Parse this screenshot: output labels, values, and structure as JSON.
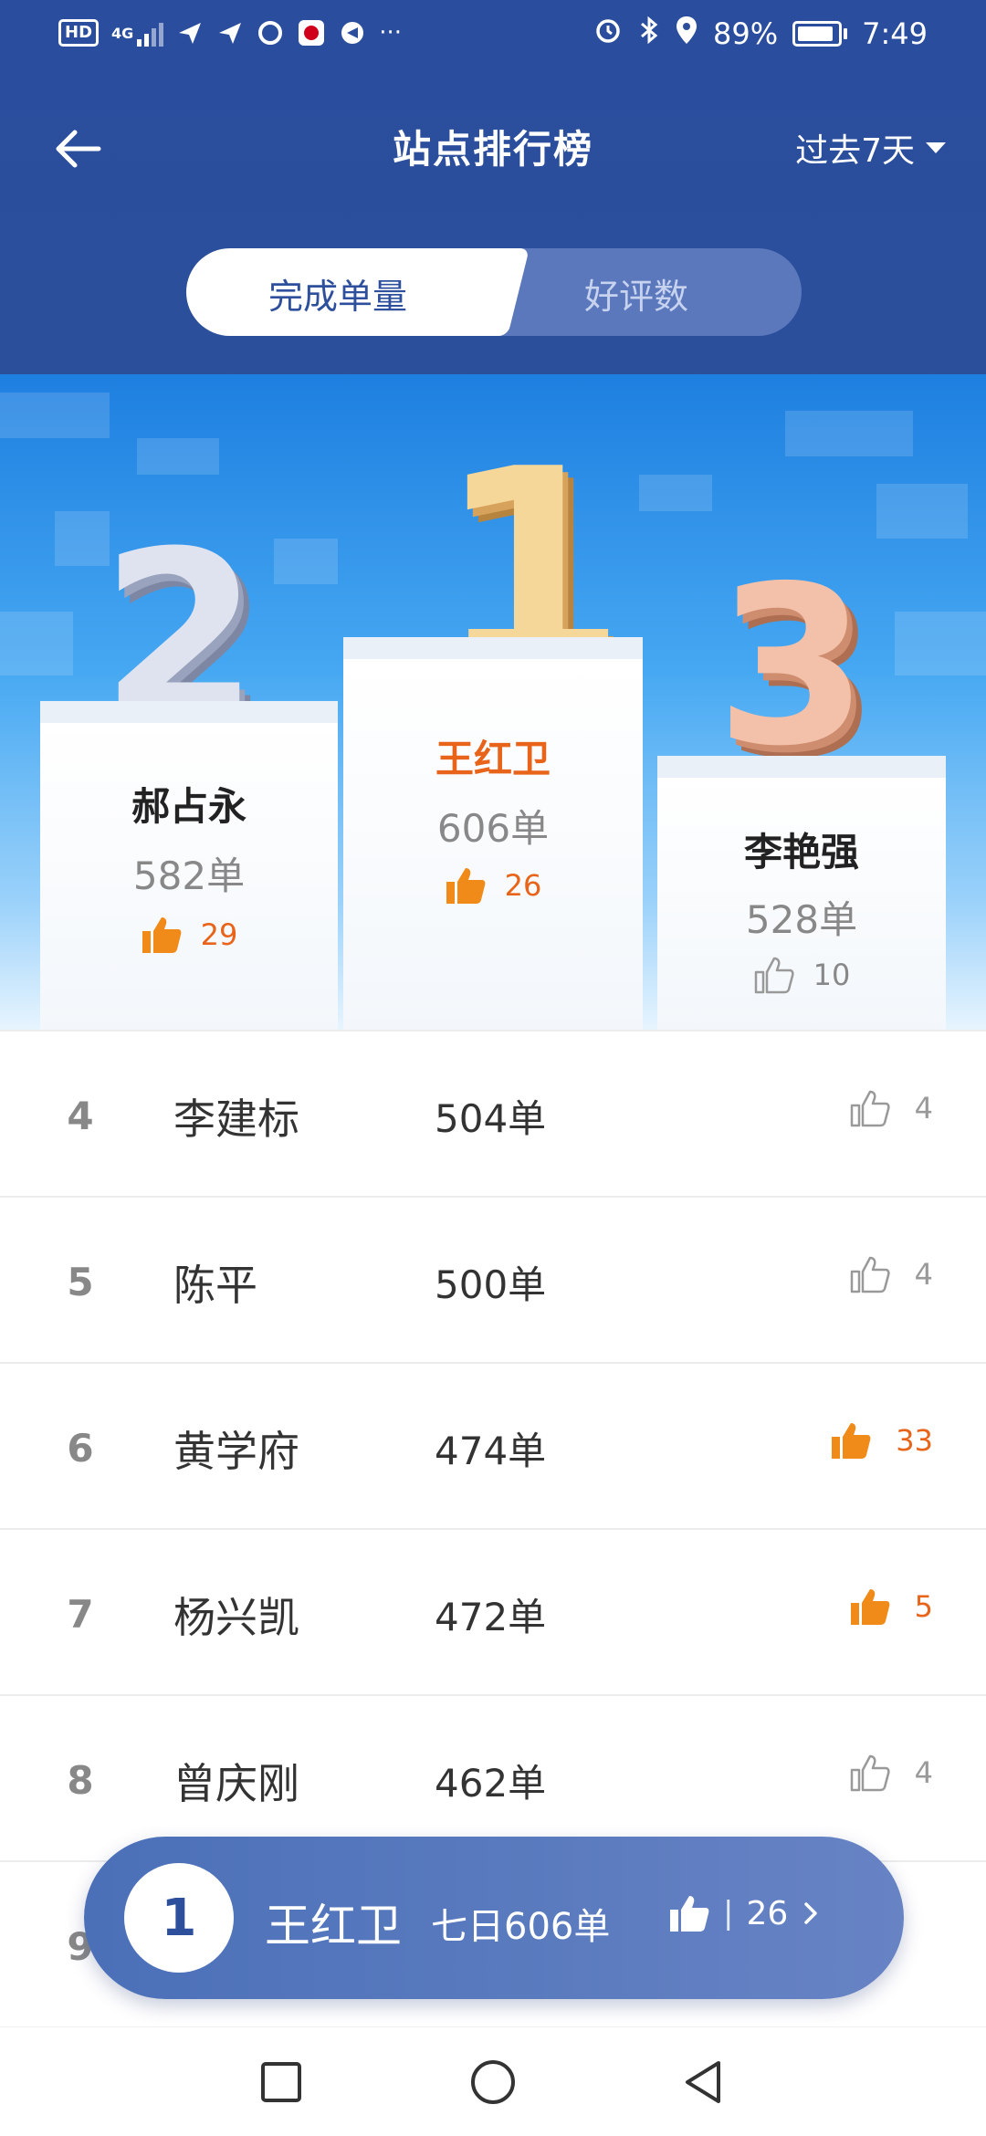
{
  "status_bar": {
    "left_icons": [
      "hd-icon",
      "4g-signal-icon",
      "paper-plane-icon",
      "paper-plane-icon",
      "app-icon",
      "bank-app-icon",
      "app-icon",
      "more-icon"
    ],
    "battery_percent": "89%",
    "time": "7:49",
    "hd_label": "HD",
    "network_label": "4G",
    "more_label": "···"
  },
  "nav": {
    "title": "站点排行榜",
    "period": "过去7天"
  },
  "tabs": [
    {
      "label": "完成单量",
      "active": true
    },
    {
      "label": "好评数",
      "active": false
    }
  ],
  "podium": {
    "first": {
      "rank": "1",
      "name": "王红卫",
      "count": "606单",
      "likes": "26",
      "liked": true
    },
    "second": {
      "rank": "2",
      "name": "郝占永",
      "count": "582单",
      "likes": "29",
      "liked": true
    },
    "third": {
      "rank": "3",
      "name": "李艳强",
      "count": "528单",
      "likes": "10",
      "liked": false
    }
  },
  "list": [
    {
      "rank": "4",
      "name": "李建标",
      "count": "504单",
      "likes": "4",
      "liked": false
    },
    {
      "rank": "5",
      "name": "陈平",
      "count": "500单",
      "likes": "4",
      "liked": false
    },
    {
      "rank": "6",
      "name": "黄学府",
      "count": "474单",
      "likes": "33",
      "liked": true
    },
    {
      "rank": "7",
      "name": "杨兴凯",
      "count": "472单",
      "likes": "5",
      "liked": true
    },
    {
      "rank": "8",
      "name": "曾庆刚",
      "count": "462单",
      "likes": "4",
      "liked": false
    },
    {
      "rank": "9",
      "name": "",
      "count": "",
      "likes": "",
      "liked": false
    }
  ],
  "my_rank": {
    "rank": "1",
    "name": "王红卫",
    "summary": "七日606单",
    "likes": "26",
    "separator": "|"
  },
  "colors": {
    "header_blue": "#2c4f9c",
    "accent_orange": "#e8641a",
    "tab_inactive": "#5b78bd"
  }
}
